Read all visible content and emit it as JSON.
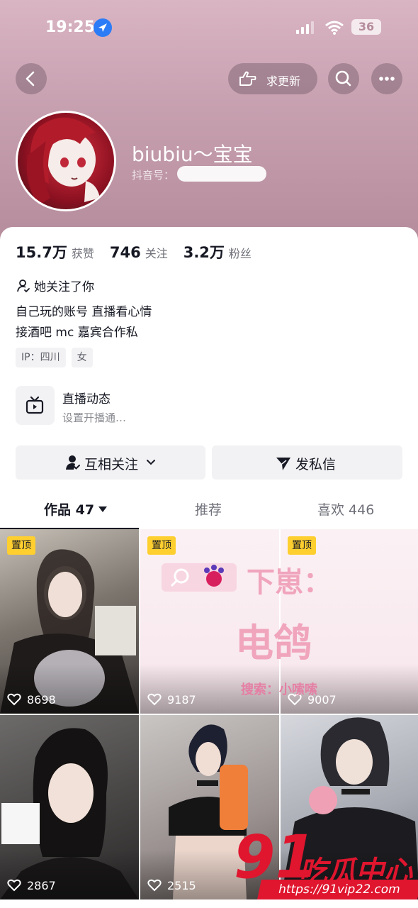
{
  "status_bar": {
    "time": "19:25",
    "battery": "36"
  },
  "header": {
    "update_button_label": "求更新",
    "nickname": "biubiu～宝宝",
    "douyin_id_label": "抖音号："
  },
  "stats": [
    {
      "value": "15.7万",
      "label": "获赞"
    },
    {
      "value": "746",
      "label": "关注"
    },
    {
      "value": "3.2万",
      "label": "粉丝"
    }
  ],
  "follows_you": "她关注了你",
  "bio": {
    "line1": "自己玩的账号 直播看心情",
    "line2": "接酒吧 mc 嘉宾合作私"
  },
  "tags": [
    "IP：四川",
    "女"
  ],
  "live": {
    "title": "直播动态",
    "subtitle": "设置开播通…"
  },
  "actions": {
    "mutual_follow": "互相关注",
    "message": "发私信"
  },
  "tabs": {
    "works": "作品 47",
    "recommend": "推荐",
    "likes": "喜欢 446"
  },
  "grid": [
    {
      "pinned": "置顶",
      "likes": "8698"
    },
    {
      "pinned": "置顶",
      "likes": "9187"
    },
    {
      "pinned": "置顶",
      "likes": "9007"
    },
    {
      "likes": "2867"
    },
    {
      "likes": "2515"
    },
    {
      "likes": ""
    }
  ],
  "promo": {
    "line1": "下崽：",
    "line2": "电鸽",
    "line3": "搜索：小嗦嗦"
  },
  "watermark": {
    "number": "91",
    "text": "吃瓜中心",
    "url": "https://91vip22.com"
  },
  "colors": {
    "accent_yellow": "#fecf2f",
    "header_pink": "#c7a0b0",
    "watermark_red": "#e0152e"
  }
}
